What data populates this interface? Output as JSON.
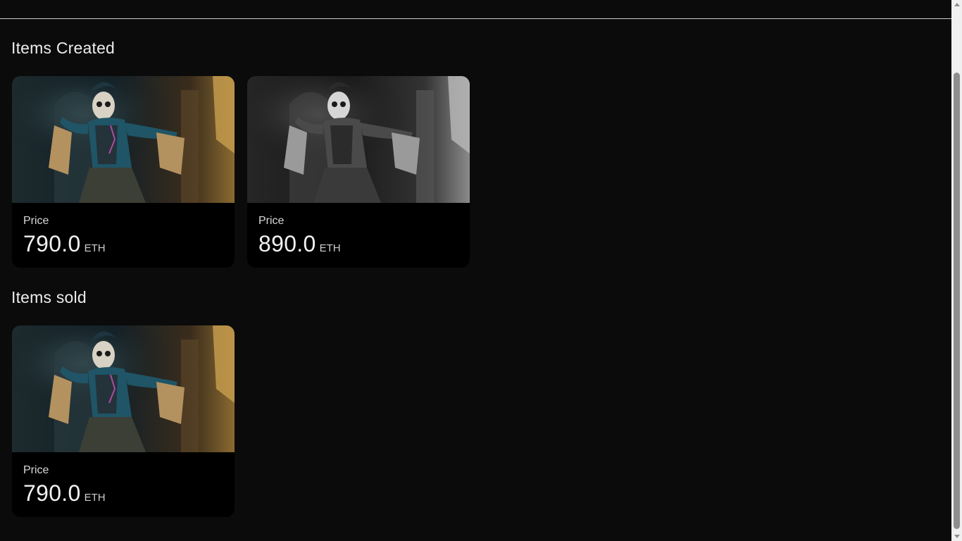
{
  "sections": [
    {
      "title": "Items Created",
      "items": [
        {
          "price_label": "Price",
          "price": "790.0",
          "unit": "ETH",
          "image": "skeleton-dancer-color"
        },
        {
          "price_label": "Price",
          "price": "890.0",
          "unit": "ETH",
          "image": "skeleton-dancer-grayscale"
        }
      ]
    },
    {
      "title": "Items sold",
      "items": [
        {
          "price_label": "Price",
          "price": "790.0",
          "unit": "ETH",
          "image": "skeleton-dancer-color"
        }
      ]
    }
  ],
  "colors": {
    "background": "#0b0b0b",
    "card": "#000000",
    "text": "#ececec"
  }
}
